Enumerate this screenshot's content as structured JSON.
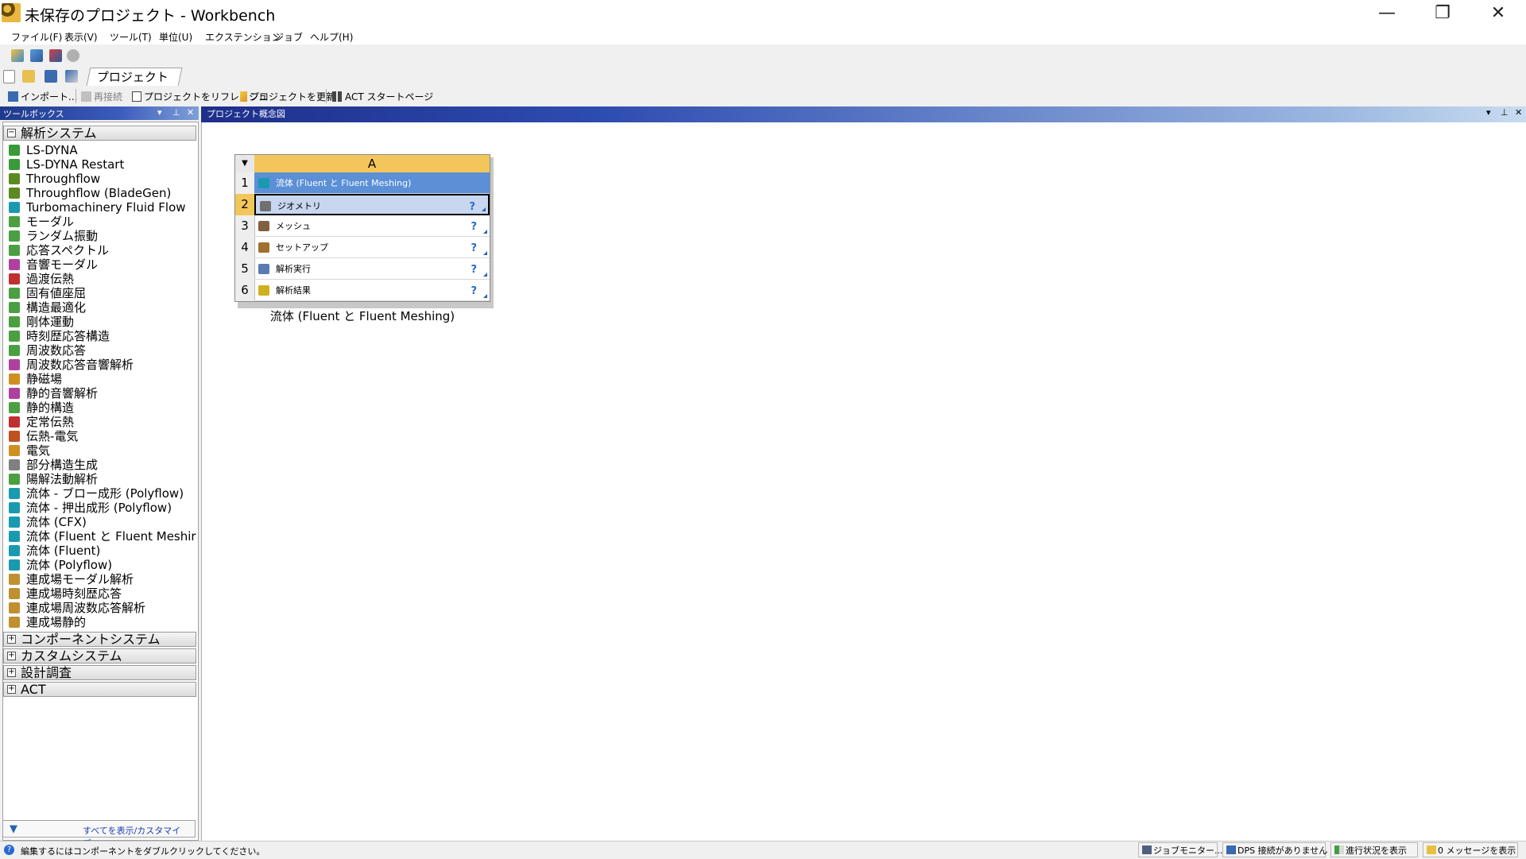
{
  "window": {
    "title": "未保存のプロジェクト - Workbench",
    "minimize": "—",
    "restore": "❐",
    "close": "✕"
  },
  "menu": [
    "ファイル(F)",
    "表示(V)",
    "ツール(T)",
    "単位(U)",
    "エクステンション",
    "ジョブ",
    "ヘルプ(H)"
  ],
  "tabs": {
    "project": "プロジェクト"
  },
  "toolbar2": {
    "import": "インポート...",
    "reconnect": "再接続",
    "refresh": "プロジェクトをリフレッシュ",
    "update": "プロジェクトを更新",
    "act_start": "ACT スタートページ"
  },
  "toolbox": {
    "title": "ツールボックス",
    "header_buttons": [
      "▾",
      "⊥",
      "✕"
    ],
    "analysis_group": "解析システム",
    "items": [
      {
        "label": "LS-DYNA",
        "icon": "ls-dyna-icon",
        "color": "#3a9a3a"
      },
      {
        "label": "LS-DYNA Restart",
        "icon": "ls-dyna-restart-icon",
        "color": "#3a9a3a"
      },
      {
        "label": "Throughflow",
        "icon": "throughflow-icon",
        "color": "#5a8a20"
      },
      {
        "label": "Throughflow (BladeGen)",
        "icon": "throughflow-bladegen-icon",
        "color": "#5a8a20"
      },
      {
        "label": "Turbomachinery Fluid Flow",
        "icon": "turbo-fluid-icon",
        "color": "#1a9ab0"
      },
      {
        "label": "モーダル",
        "icon": "modal-icon",
        "color": "#4aa040"
      },
      {
        "label": "ランダム振動",
        "icon": "random-vibration-icon",
        "color": "#4aa040"
      },
      {
        "label": "応答スペクトル",
        "icon": "response-spectrum-icon",
        "color": "#4aa040"
      },
      {
        "label": "音響モーダル",
        "icon": "acoustic-modal-icon",
        "color": "#b040a0"
      },
      {
        "label": "過渡伝熱",
        "icon": "transient-thermal-icon",
        "color": "#c03030"
      },
      {
        "label": "固有値座屈",
        "icon": "eigen-buckling-icon",
        "color": "#4aa040"
      },
      {
        "label": "構造最適化",
        "icon": "topology-opt-icon",
        "color": "#4aa040"
      },
      {
        "label": "剛体運動",
        "icon": "rigid-dynamics-icon",
        "color": "#4aa040"
      },
      {
        "label": "時刻歴応答構造",
        "icon": "transient-structural-icon",
        "color": "#4aa040"
      },
      {
        "label": "周波数応答",
        "icon": "harmonic-response-icon",
        "color": "#4aa040"
      },
      {
        "label": "周波数応答音響解析",
        "icon": "harmonic-acoustics-icon",
        "color": "#b040a0"
      },
      {
        "label": "静磁場",
        "icon": "magnetostatic-icon",
        "color": "#d09020"
      },
      {
        "label": "静的音響解析",
        "icon": "static-acoustics-icon",
        "color": "#b040a0"
      },
      {
        "label": "静的構造",
        "icon": "static-structural-icon",
        "color": "#4aa040"
      },
      {
        "label": "定常伝熱",
        "icon": "steady-thermal-icon",
        "color": "#c03030"
      },
      {
        "label": "伝熱-電気",
        "icon": "thermal-electric-icon",
        "color": "#c05020"
      },
      {
        "label": "電気",
        "icon": "electric-icon",
        "color": "#d09020"
      },
      {
        "label": "部分構造生成",
        "icon": "substructure-icon",
        "color": "#808080"
      },
      {
        "label": "陽解法動解析",
        "icon": "explicit-dynamics-icon",
        "color": "#4aa040"
      },
      {
        "label": "流体 - ブロー成形 (Polyflow)",
        "icon": "polyflow-blow-icon",
        "color": "#1a9ab0"
      },
      {
        "label": "流体 - 押出成形 (Polyflow)",
        "icon": "polyflow-extrusion-icon",
        "color": "#1a9ab0"
      },
      {
        "label": "流体 (CFX)",
        "icon": "cfx-icon",
        "color": "#1a9ab0"
      },
      {
        "label": "流体 (Fluent と Fluent Meshir",
        "icon": "fluent-meshing-icon",
        "color": "#1a9ab0"
      },
      {
        "label": "流体 (Fluent)",
        "icon": "fluent-icon",
        "color": "#1a9ab0"
      },
      {
        "label": "流体 (Polyflow)",
        "icon": "polyflow-icon",
        "color": "#1a9ab0"
      },
      {
        "label": "連成場モーダル解析",
        "icon": "coupled-modal-icon",
        "color": "#c09030"
      },
      {
        "label": "連成場時刻歴応答",
        "icon": "coupled-transient-icon",
        "color": "#c09030"
      },
      {
        "label": "連成場周波数応答解析",
        "icon": "coupled-harmonic-icon",
        "color": "#c09030"
      },
      {
        "label": "連成場静的",
        "icon": "coupled-static-icon",
        "color": "#c09030"
      }
    ],
    "collapsed_groups": [
      "コンポーネントシステム",
      "カスタムシステム",
      "設計調査",
      "ACT"
    ],
    "show_all": "すべてを表示/カスタマイズ..."
  },
  "schematic": {
    "title": "プロジェクト概念図",
    "header_buttons": [
      "▾",
      "⊥",
      "✕"
    ],
    "system": {
      "column": "A",
      "dropdown": "▼",
      "rows": [
        {
          "num": "1",
          "label": "流体 (Fluent と Fluent Meshing)",
          "icon": "fluent-system-icon",
          "status": ""
        },
        {
          "num": "2",
          "label": "ジオメトリ",
          "icon": "geometry-icon",
          "status": "?"
        },
        {
          "num": "3",
          "label": "メッシュ",
          "icon": "mesh-icon",
          "status": "?"
        },
        {
          "num": "4",
          "label": "セットアップ",
          "icon": "setup-icon",
          "status": "?"
        },
        {
          "num": "5",
          "label": "解析実行",
          "icon": "solution-icon",
          "status": "?"
        },
        {
          "num": "6",
          "label": "解析結果",
          "icon": "results-icon",
          "status": "?"
        }
      ],
      "caption": "流体 (Fluent と Fluent  Meshing)"
    }
  },
  "statusbar": {
    "message": "編集するにはコンポーネントをダブルクリックしてください。",
    "job_monitor": "ジョブモニター...",
    "dps": "DPS 接続がありません",
    "progress": "進行状況を表示",
    "messages": "0 メッセージを表示"
  },
  "colors": {
    "header_blue": "#1e3a8a",
    "column_header": "#f2c65a",
    "row1_selected": "#5b8fd6",
    "row2_selected": "#c8d6f0"
  }
}
